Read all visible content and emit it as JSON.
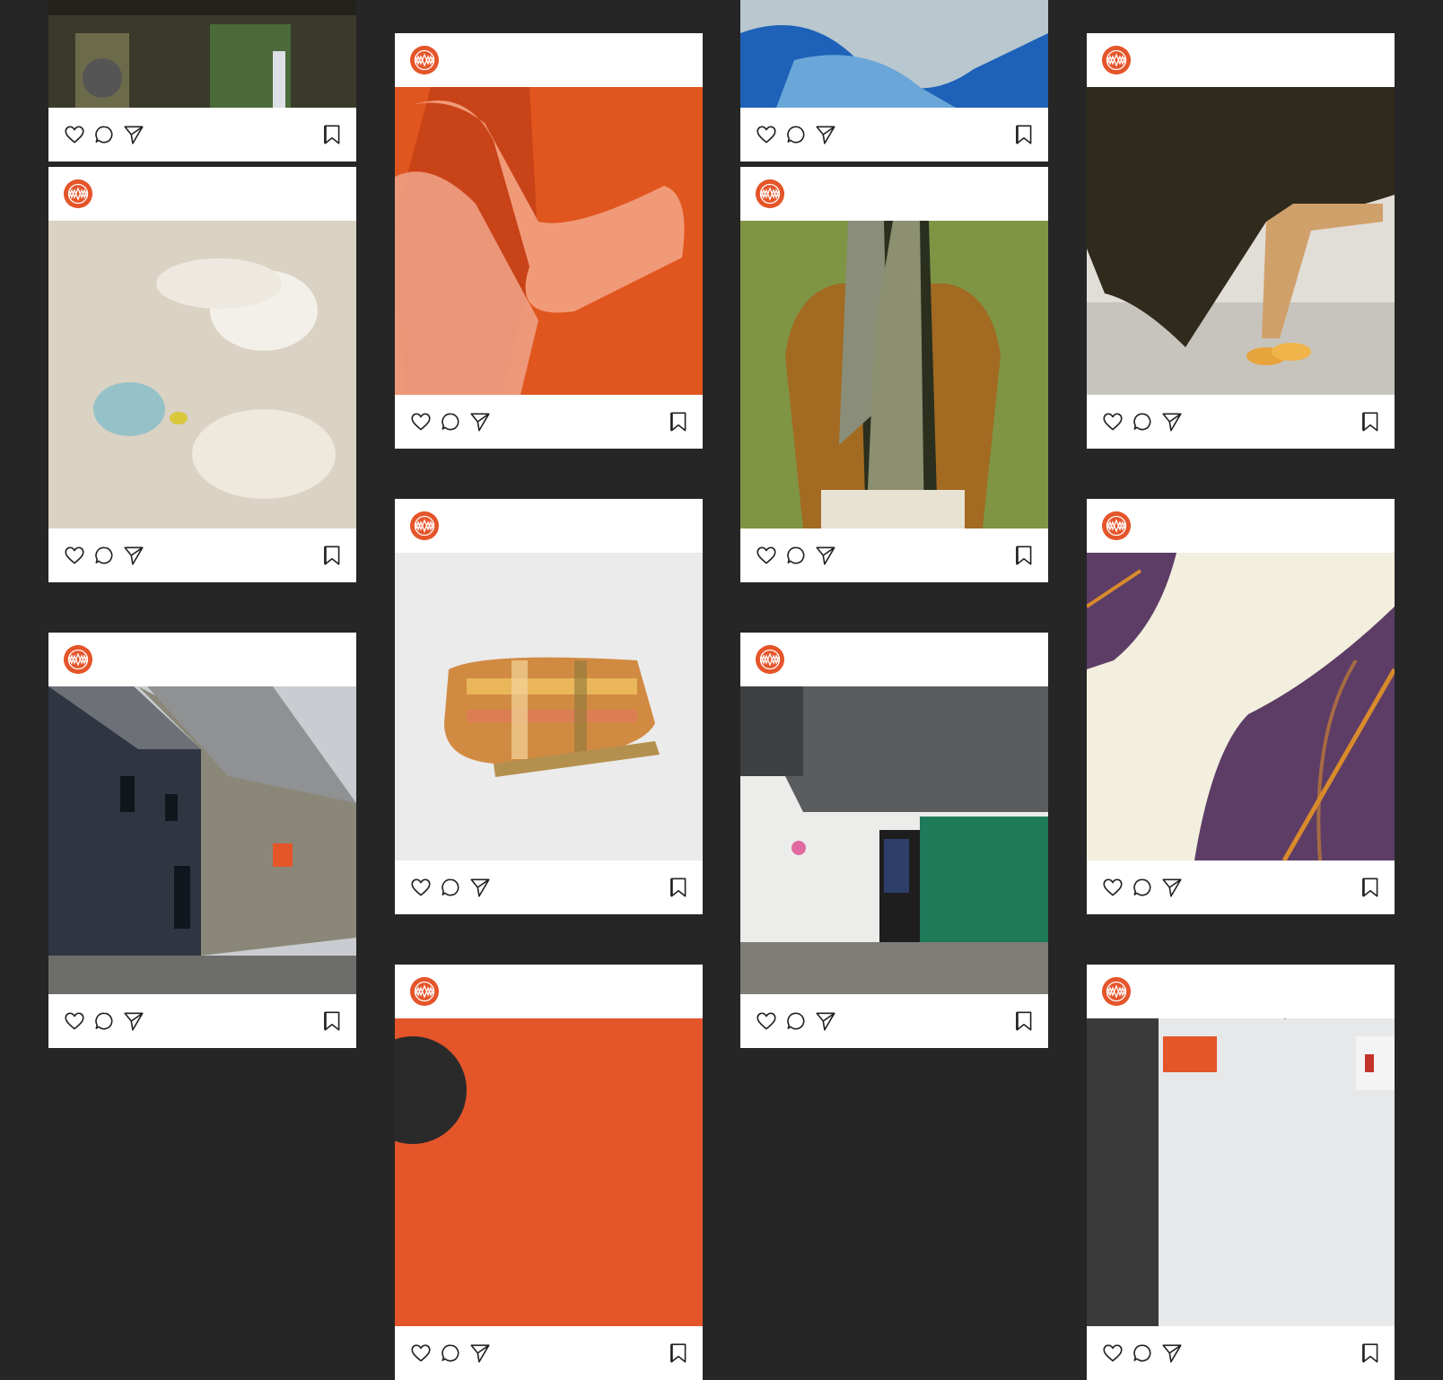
{
  "page": {
    "background": "#262626",
    "brand_color": "#e5552a"
  },
  "post_icons": {
    "avatar": "brand-logo-icon",
    "like": "heart-icon",
    "comment": "speech-bubble-icon",
    "share": "paper-plane-icon",
    "save": "bookmark-icon"
  },
  "posts": [
    {
      "image": "weaving-loom-machinery",
      "colors": [
        "#3b3a2a",
        "#6b6a4a",
        "#22211a"
      ]
    },
    {
      "image": "orange-mohair-scarf",
      "colors": [
        "#e0561e",
        "#f19a78",
        "#c7421a"
      ]
    },
    {
      "image": "blue-dyed-fleece",
      "colors": [
        "#1d62b8",
        "#6aa6d8",
        "#b9c7cf"
      ]
    },
    {
      "image": "brown-blanket-on-bed",
      "colors": [
        "#c7c4bd",
        "#2f2a1c",
        "#e8a43c"
      ]
    },
    {
      "image": "sheep-and-lamb",
      "colors": [
        "#e8e1d5",
        "#b8ad98",
        "#5db5cc"
      ]
    },
    {
      "image": "man-wearing-grey-scarf",
      "colors": [
        "#7f9544",
        "#8a8e78",
        "#a36a22"
      ]
    },
    {
      "image": "street-of-buildings",
      "colors": [
        "#c9ccd0",
        "#2f3642",
        "#8b8778"
      ]
    },
    {
      "image": "folded-check-throw",
      "colors": [
        "#ebebeb",
        "#d18a42",
        "#b4904e"
      ]
    },
    {
      "image": "purple-check-blanket-closeup",
      "colors": [
        "#f2efde",
        "#5d3d66",
        "#d98a2b"
      ]
    },
    {
      "image": "cottage-green-door",
      "colors": [
        "#ececea",
        "#5b5c5e",
        "#1f7a5a"
      ]
    },
    {
      "image": "orange-portrait",
      "colors": [
        "#e5552a",
        "#2a2a2a",
        "#e5552a"
      ]
    },
    {
      "image": "shop-sign-street",
      "colors": [
        "#dfe3e6",
        "#a9aeb2",
        "#e5552a"
      ]
    }
  ]
}
